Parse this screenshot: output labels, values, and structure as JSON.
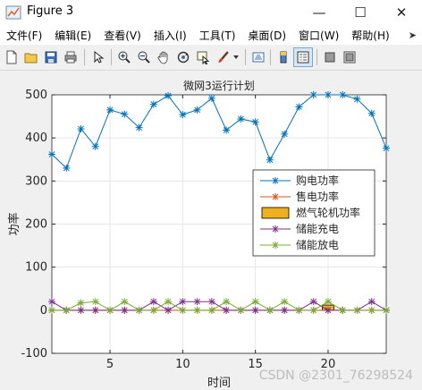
{
  "window": {
    "title": "Figure 3",
    "minimize_glyph": "—",
    "maximize_glyph": "☐",
    "close_glyph": "✕"
  },
  "menu": {
    "items": [
      "文件(F)",
      "编辑(E)",
      "查看(V)",
      "插入(I)",
      "工具(T)",
      "桌面(D)",
      "窗口(W)",
      "帮助(H)"
    ],
    "overflow_glyph": "➤"
  },
  "toolbar": {
    "icons": [
      "new-figure-icon",
      "open-file-icon",
      "save-icon",
      "print-icon",
      "select-arrow-icon",
      "zoom-in-icon",
      "zoom-out-icon",
      "pan-hand-icon",
      "rotate-3d-icon",
      "data-cursor-icon",
      "brush-icon",
      "link-plot-icon",
      "colorbar-icon",
      "legend-icon",
      "hide-plot-tools-icon",
      "show-plot-tools-icon"
    ]
  },
  "colors": {
    "series1": "#0072BD",
    "series2": "#D95319",
    "series3": "#EDB120",
    "series4": "#7E2F8E",
    "series5": "#77AC30"
  },
  "watermark": "CSDN @2301_76298524",
  "chart_data": {
    "type": "line",
    "title": "微网3运行计划",
    "xlabel": "时间",
    "ylabel": "功率",
    "xlim": [
      1,
      24
    ],
    "ylim": [
      -100,
      500
    ],
    "xticks": [
      5,
      10,
      15,
      20
    ],
    "yticks": [
      -100,
      0,
      100,
      200,
      300,
      400,
      500
    ],
    "grid": true,
    "legend_position": "right",
    "x": [
      1,
      2,
      3,
      4,
      5,
      6,
      7,
      8,
      9,
      10,
      11,
      12,
      13,
      14,
      15,
      16,
      17,
      18,
      19,
      20,
      21,
      22,
      23,
      24
    ],
    "series": [
      {
        "name": "购电功率",
        "type": "line",
        "values": [
          362,
          330,
          421,
          380,
          465,
          455,
          424,
          478,
          498,
          454,
          465,
          492,
          418,
          444,
          437,
          349,
          409,
          472,
          500,
          500,
          500,
          490,
          457,
          376
        ]
      },
      {
        "name": "售电功率",
        "type": "line",
        "values": [
          0,
          0,
          0,
          0,
          0,
          0,
          0,
          0,
          0,
          0,
          0,
          0,
          0,
          0,
          0,
          0,
          0,
          0,
          0,
          0,
          0,
          0,
          0,
          0
        ]
      },
      {
        "name": "燃气轮机功率",
        "type": "bar",
        "values": [
          0,
          0,
          0,
          0,
          0,
          0,
          0,
          0,
          0,
          0,
          0,
          0,
          0,
          0,
          0,
          0,
          0,
          0,
          0,
          12,
          0,
          0,
          0,
          0
        ]
      },
      {
        "name": "储能充电",
        "type": "line",
        "values": [
          20,
          0,
          0,
          0,
          0,
          0,
          0,
          20,
          0,
          20,
          20,
          20,
          0,
          0,
          0,
          0,
          0,
          0,
          20,
          0,
          0,
          0,
          20,
          0
        ]
      },
      {
        "name": "储能放电",
        "type": "line",
        "values": [
          0,
          0,
          17,
          20,
          0,
          20,
          0,
          0,
          20,
          0,
          0,
          0,
          20,
          0,
          20,
          0,
          20,
          0,
          0,
          20,
          0,
          0,
          0,
          0
        ]
      }
    ]
  }
}
